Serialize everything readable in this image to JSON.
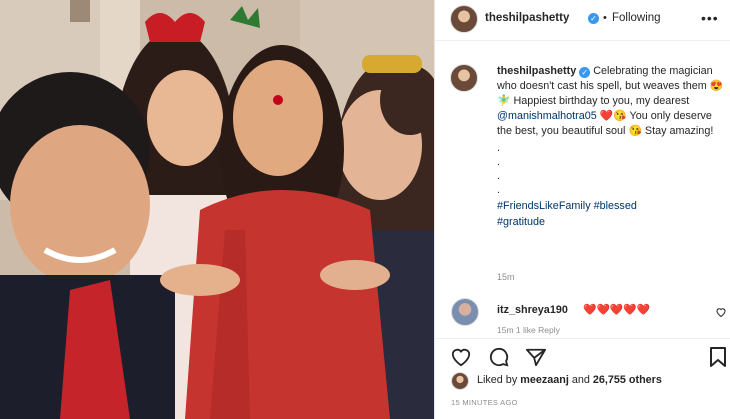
{
  "header": {
    "username": "theshilpashetty",
    "follow_status": "Following",
    "separator": "•",
    "more_glyph": "•••"
  },
  "caption": {
    "username": "theshilpashetty",
    "text_1": "Celebrating the magician who doesn't cast his spell, but weaves them",
    "emoji_1": "😍",
    "text_2": "🧚‍♂️ Happiest birthday to you, my dearest",
    "mention": "@manishmalhotra05",
    "emoji_2": "❤️😘",
    "text_3": "You only deserve the best, you beautiful soul",
    "emoji_3": "😘",
    "text_4": "Stay amazing!",
    "dots": ".",
    "hashtag_1": "#FriendsLikeFamily",
    "hashtag_2": "#blessed",
    "hashtag_3": "#gratitude",
    "time": "15m"
  },
  "comment": {
    "username": "itz_shreya190",
    "text": "❤️❤️❤️❤️❤️",
    "meta": "15m  1 like  Reply"
  },
  "actions": {
    "like_icon": "heart-icon",
    "comment_icon": "comment-icon",
    "share_icon": "paper-plane-icon",
    "save_icon": "bookmark-icon"
  },
  "likes": {
    "prefix": "Liked by",
    "user": "meezaanj",
    "middle": "and",
    "count": "26,755 others"
  },
  "timestamp": "15 MINUTES AGO",
  "colors": {
    "verified": "#3897f0",
    "link": "#003569",
    "muted": "#8e8e8e"
  }
}
